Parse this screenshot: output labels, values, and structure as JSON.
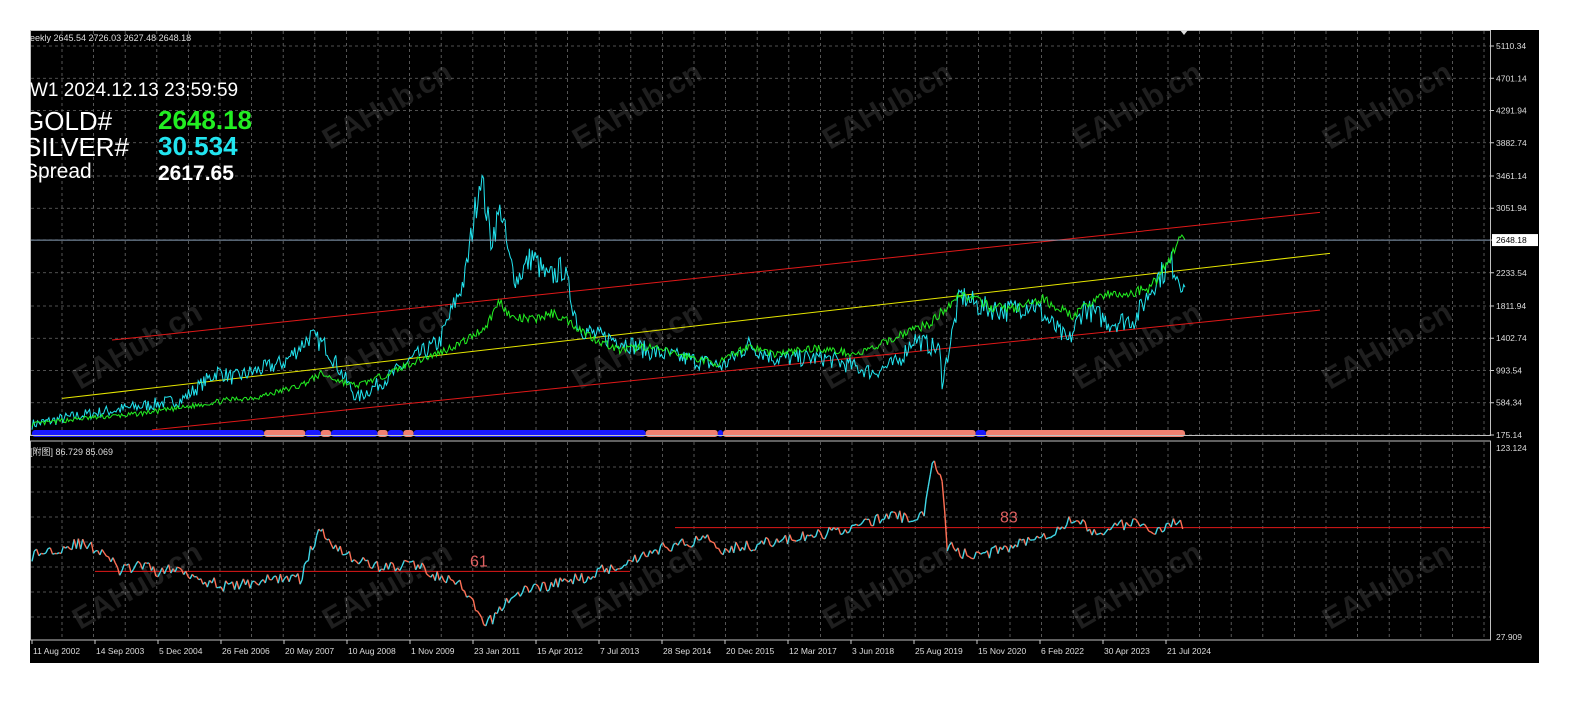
{
  "header": {
    "price_line": "eekly  2645.54 2726.03 2627.48 2648.18",
    "timestamp": "W1  2024.12.13 23:59:59",
    "symbols": [
      {
        "label": "GOLD#",
        "value": "2648.18",
        "color": "#22ee22"
      },
      {
        "label": "SILVER#",
        "value": "30.534",
        "color": "#22e5f0"
      },
      {
        "label": "Spread",
        "value": "2617.65",
        "color": "#ffffff"
      }
    ]
  },
  "subwindow": {
    "label": "[附图] 86.729 85.069"
  },
  "watermark": "EAHub.cn",
  "colors": {
    "gold": "#22ee22",
    "silver": "#22e5f0",
    "channel": "#e01818",
    "midline": "#e6e600",
    "bar_blue": "#1a1aff",
    "bar_salmon": "#f08070",
    "ratio_up": "#40d8e8",
    "ratio_down": "#ff7055",
    "level": "#e01818"
  },
  "chart_data": [
    {
      "type": "line",
      "panel": "main",
      "y_ticks": [
        "5110.34",
        "4701.14",
        "4291.94",
        "3882.74",
        "3461.14",
        "3051.94",
        "2648.18",
        "2233.54",
        "1811.94",
        "1402.74",
        "993.54",
        "584.34",
        "175.14"
      ],
      "ylim": [
        175.14,
        5300
      ],
      "current_price": "2648.18",
      "x_ticks": [
        "11 Aug 2002",
        "14 Sep 2003",
        "5 Dec 2004",
        "26 Feb 2006",
        "20 May 2007",
        "10 Aug 2008",
        "1 Nov 2009",
        "23 Jan 2011",
        "15 Apr 2012",
        "7 Jul 2013",
        "28 Sep 2014",
        "20 Dec 2015",
        "12 Mar 2017",
        "3 Jun 2018",
        "25 Aug 2019",
        "15 Nov 2020",
        "6 Feb 2022",
        "30 Apr 2023",
        "21 Jul 2024"
      ],
      "x_range": [
        2002.6,
        2024.96
      ],
      "series": [
        {
          "name": "GOLD#",
          "color": "#22ee22",
          "x": [
            2002.6,
            2003.5,
            2004.5,
            2005.5,
            2006.4,
            2007.0,
            2007.8,
            2008.2,
            2008.7,
            2008.9,
            2009.5,
            2010.0,
            2010.5,
            2011.0,
            2011.4,
            2011.67,
            2011.9,
            2012.3,
            2012.7,
            2013.0,
            2013.5,
            2014.0,
            2014.5,
            2015.0,
            2015.9,
            2016.5,
            2017.0,
            2017.8,
            2018.6,
            2019.0,
            2019.6,
            2020.0,
            2020.6,
            2021.2,
            2021.7,
            2022.2,
            2022.8,
            2023.3,
            2023.8,
            2024.3,
            2024.7,
            2024.9,
            2024.96
          ],
          "y": [
            310,
            380,
            430,
            520,
            620,
            660,
            800,
            950,
            830,
            800,
            950,
            1100,
            1220,
            1370,
            1550,
            1880,
            1660,
            1640,
            1720,
            1620,
            1400,
            1250,
            1300,
            1220,
            1080,
            1310,
            1200,
            1280,
            1200,
            1300,
            1500,
            1580,
            1970,
            1800,
            1780,
            1900,
            1680,
            1950,
            1950,
            2050,
            2450,
            2730,
            2648
          ]
        },
        {
          "name": "SILVER#",
          "color": "#22e5f0",
          "x": [
            2002.6,
            2003.5,
            2004.5,
            2005.5,
            2006.2,
            2006.5,
            2007.5,
            2008.0,
            2008.3,
            2008.9,
            2009.5,
            2010.0,
            2010.5,
            2011.0,
            2011.3,
            2011.5,
            2011.7,
            2011.85,
            2012.0,
            2012.3,
            2012.6,
            2012.9,
            2013.2,
            2013.6,
            2014.0,
            2014.5,
            2015.0,
            2016.0,
            2016.5,
            2017.0,
            2018.0,
            2018.9,
            2019.4,
            2019.7,
            2020.2,
            2020.25,
            2020.6,
            2021.0,
            2021.5,
            2022.0,
            2022.7,
            2023.0,
            2023.5,
            2024.0,
            2024.4,
            2024.7,
            2024.96
          ],
          "y": [
            310,
            420,
            520,
            620,
            980,
            900,
            1100,
            1430,
            1300,
            640,
            900,
            1150,
            1350,
            2180,
            3500,
            2650,
            3050,
            2400,
            2150,
            2450,
            2150,
            2300,
            1550,
            1420,
            1380,
            1250,
            1180,
            1050,
            1320,
            1150,
            1150,
            970,
            1100,
            1400,
            1250,
            850,
            1950,
            1800,
            1750,
            1850,
            1350,
            1800,
            1600,
            1650,
            2150,
            2350,
            2050
          ]
        }
      ],
      "channel_lines": [
        {
          "name": "upper",
          "color": "#e01818",
          "x": [
            2002.6,
            2024.96
          ],
          "y": [
            1380,
            3000
          ]
        },
        {
          "name": "mid",
          "color": "#e6e600",
          "x": [
            2002.6,
            2024.96
          ],
          "y": [
            640,
            2480
          ]
        },
        {
          "name": "lower",
          "color": "#e01818",
          "x": [
            2002.6,
            2024.96
          ],
          "y": [
            240,
            1760
          ]
        }
      ],
      "bottom_bars": [
        {
          "color": "#1a1aff",
          "x": [
            2002.6,
            2007.1
          ]
        },
        {
          "color": "#f08070",
          "x": [
            2007.1,
            2007.9
          ]
        },
        {
          "color": "#1a1aff",
          "x": [
            2007.9,
            2008.2
          ]
        },
        {
          "color": "#f08070",
          "x": [
            2008.2,
            2008.4
          ]
        },
        {
          "color": "#1a1aff",
          "x": [
            2008.4,
            2009.3
          ]
        },
        {
          "color": "#f08070",
          "x": [
            2009.3,
            2009.5
          ]
        },
        {
          "color": "#1a1aff",
          "x": [
            2009.5,
            2009.8
          ]
        },
        {
          "color": "#f08070",
          "x": [
            2009.8,
            2010.0
          ]
        },
        {
          "color": "#1a1aff",
          "x": [
            2010.0,
            2014.5
          ]
        },
        {
          "color": "#f08070",
          "x": [
            2014.5,
            2015.9
          ]
        },
        {
          "color": "#1a1aff",
          "x": [
            2015.9,
            2016.0
          ]
        },
        {
          "color": "#f08070",
          "x": [
            2016.0,
            2020.9
          ]
        },
        {
          "color": "#1a1aff",
          "x": [
            2020.9,
            2021.1
          ]
        },
        {
          "color": "#f08070",
          "x": [
            2021.1,
            2024.96
          ]
        }
      ]
    },
    {
      "type": "line",
      "panel": "ratio",
      "y_ticks": [
        "123.124",
        "27.909"
      ],
      "ylim": [
        27.909,
        123.124
      ],
      "levels": [
        {
          "label": "61",
          "value": 61,
          "x": [
            2002.6,
            2011.7
          ]
        },
        {
          "label": "83",
          "value": 83,
          "x": [
            2012.5,
            2025.9
          ]
        }
      ],
      "series": [
        {
          "name": "ratio",
          "x": [
            2002.6,
            2003.0,
            2003.5,
            2004.0,
            2004.3,
            2004.7,
            2005.0,
            2005.5,
            2006.0,
            2006.4,
            2007.0,
            2007.5,
            2007.8,
            2008.0,
            2008.2,
            2008.4,
            2008.8,
            2009.2,
            2009.6,
            2010.0,
            2010.5,
            2010.9,
            2011.2,
            2011.4,
            2011.8,
            2012.2,
            2012.8,
            2013.3,
            2013.7,
            2014.0,
            2014.5,
            2015.0,
            2015.3,
            2015.7,
            2016.0,
            2016.5,
            2017.0,
            2017.8,
            2018.5,
            2019.0,
            2019.3,
            2019.6,
            2019.9,
            2020.1,
            2020.25,
            2020.35,
            2020.6,
            2021.0,
            2021.5,
            2022.0,
            2022.4,
            2022.8,
            2023.2,
            2023.6,
            2024.0,
            2024.3,
            2024.6,
            2024.96
          ],
          "y": [
            69,
            72,
            75,
            71,
            61,
            64,
            61,
            62,
            56,
            53,
            56,
            58,
            57,
            71,
            82,
            76,
            68,
            64,
            63,
            65,
            58,
            54,
            42,
            33,
            46,
            52,
            55,
            58,
            62,
            64,
            70,
            74,
            75,
            79,
            72,
            74,
            76,
            79,
            83,
            87,
            90,
            87,
            91,
            118,
            107,
            74,
            70,
            69,
            73,
            78,
            81,
            88,
            80,
            84,
            85,
            80,
            85,
            85
          ]
        }
      ],
      "current_label": "[附图] 86.729 85.069"
    }
  ]
}
